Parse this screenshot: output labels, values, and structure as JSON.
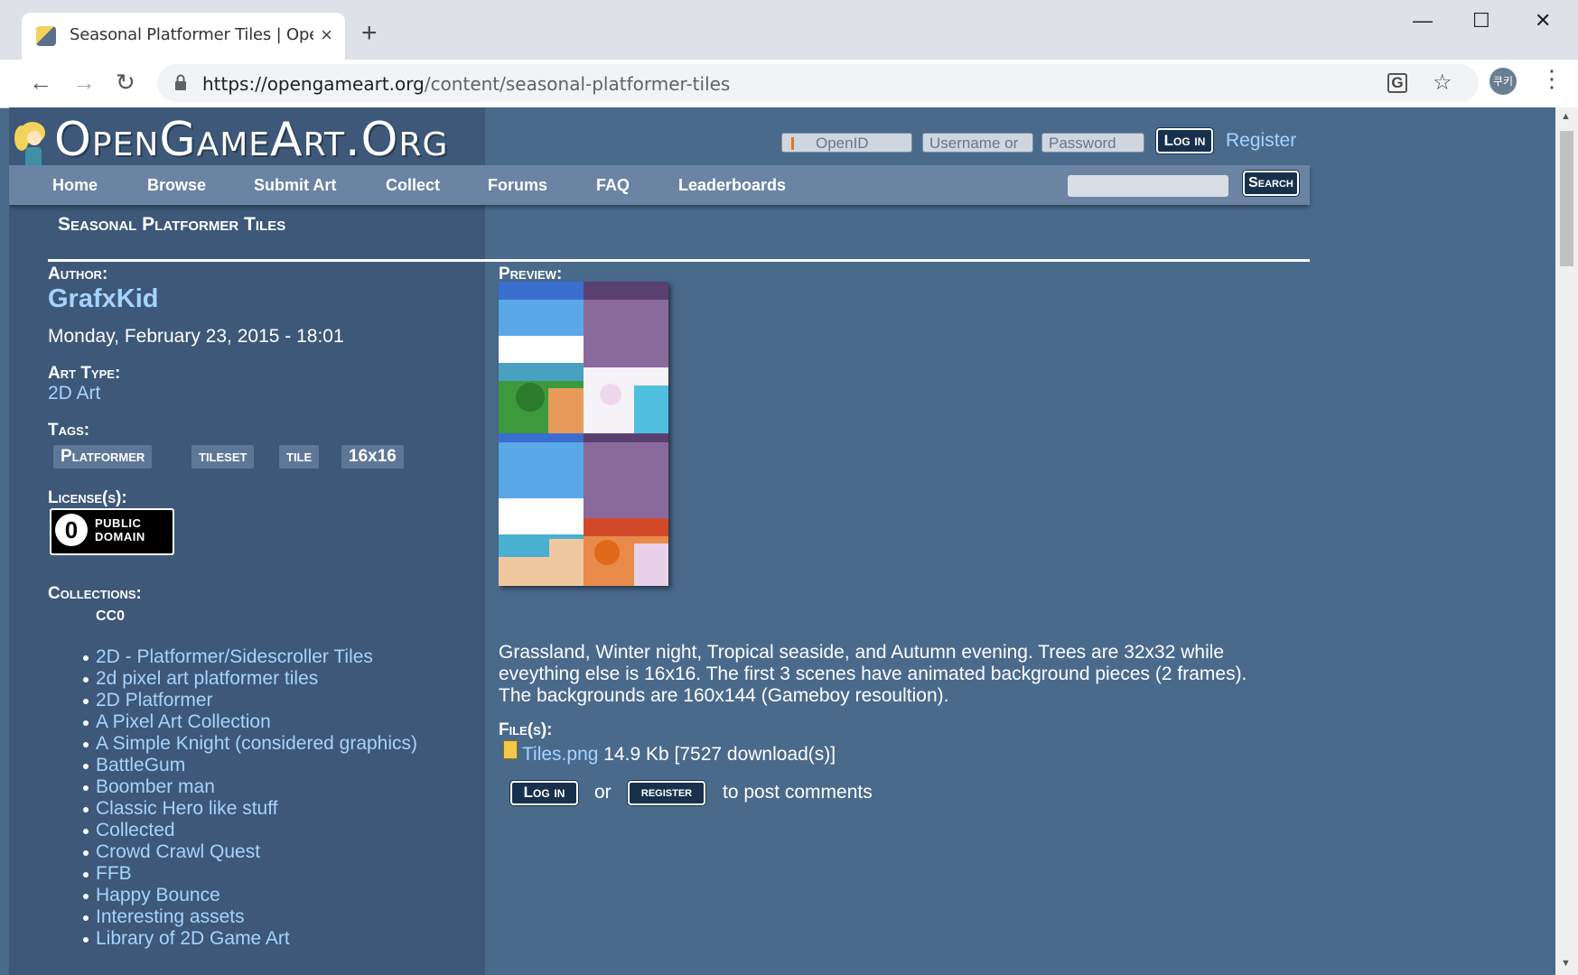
{
  "browser": {
    "tab_title": "Seasonal Platformer Tiles | OpenGameArt.org",
    "tab_close": "×",
    "new_tab": "+",
    "url_host": "https://opengameart.org",
    "url_path": "/content/seasonal-platformer-tiles",
    "back": "←",
    "forward": "→",
    "reload": "↻",
    "minimize": "—",
    "maximize": "☐",
    "close": "✕",
    "translate": "G",
    "bookmark": "☆",
    "avatar": "쿠키",
    "menu": "⋮"
  },
  "site": {
    "logo": "OpenGameArt.Org",
    "openid_placeholder": "OpenID",
    "username_placeholder": "Username or",
    "password_placeholder": "Password",
    "login_label": "Log in",
    "register_label": "Register",
    "nav": [
      "Home",
      "Browse",
      "Submit Art",
      "Collect",
      "Forums",
      "FAQ",
      "Leaderboards"
    ],
    "search_label": "Search"
  },
  "content": {
    "title": "Seasonal Platformer Tiles",
    "author_label": "Author:",
    "author": "GrafxKid",
    "date": "Monday, February 23, 2015 - 18:01",
    "art_type_label": "Art Type:",
    "art_type": "2D Art",
    "tags_label": "Tags:",
    "tags": [
      "Platformer",
      "tileset",
      "tile",
      "16x16"
    ],
    "licenses_label": "License(s):",
    "license_badge_line1": "PUBLIC",
    "license_badge_line2": "DOMAIN",
    "license_name": "CC0",
    "collections_label": "Collections:",
    "collections": [
      "2D - Platformer/Sidescroller Tiles",
      "2d pixel art platformer tiles",
      "2D Platformer",
      "A Pixel Art Collection",
      "A Simple Knight (considered graphics)",
      "BattleGum",
      "Boomber man",
      "Classic Hero like stuff",
      "Collected",
      "Crowd Crawl Quest",
      "FFB",
      "Happy Bounce",
      "Interesting assets",
      "Library of 2D Game Art"
    ],
    "preview_label": "Preview:",
    "description": "Grassland, Winter night, Tropical seaside, and Autumn evening. Trees are 32x32 while eveything else is 16x16. The first 3 scenes have animated background pieces (2 frames). The backgrounds are 160x144 (Gameboy resoultion).",
    "files_label": "File(s):",
    "file_name": "Tiles.png",
    "file_info": "14.9 Kb [7527 download(s)]",
    "comment_login": "Log in",
    "comment_or": "or",
    "comment_register": "register",
    "comment_suffix": "to post comments"
  },
  "colors": {
    "page_bg": "#4a6a8c",
    "left_col_bg": "#3d5878",
    "nav_bg": "#6b84a3",
    "link": "#a6d3ff",
    "button_bg": "#17314d"
  }
}
